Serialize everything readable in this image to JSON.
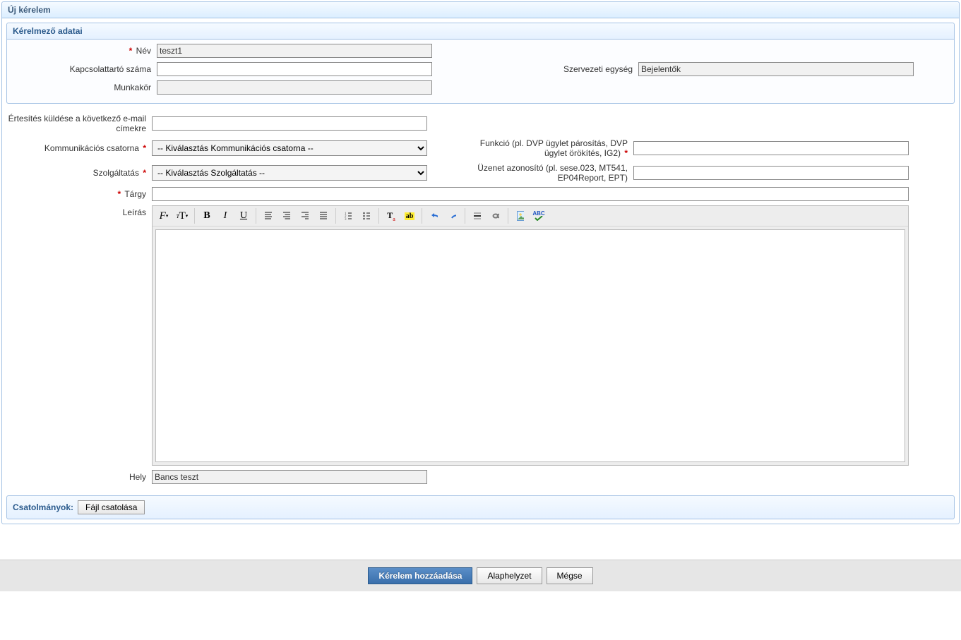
{
  "page": {
    "title": "Új kérelem"
  },
  "requester": {
    "section_title": "Kérelmező adatai",
    "labels": {
      "name": "Név",
      "contact_number": "Kapcsolattartó száma",
      "org_unit": "Szervezeti egység",
      "role": "Munkakör"
    },
    "values": {
      "name": "teszt1",
      "contact_number": "",
      "org_unit": "Bejelentők",
      "role": ""
    }
  },
  "details": {
    "labels": {
      "notify_emails": "Értesítés küldése a következő e-mail címekre",
      "comm_channel": "Kommunikációs csatorna",
      "function": "Funkció (pl. DVP ügylet párosítás, DVP ügylet örökítés, IG2)",
      "service": "Szolgáltatás",
      "message_id": "Üzenet azonosító (pl. sese.023, MT541, EP04Report, EPT)",
      "subject": "Tárgy",
      "description": "Leírás",
      "location": "Hely"
    },
    "values": {
      "notify_emails": "",
      "comm_channel": "-- Kiválasztás Kommunikációs csatorna --",
      "function": "",
      "service": "-- Kiválasztás Szolgáltatás --",
      "message_id": "",
      "subject": "",
      "location": "Bancs teszt"
    }
  },
  "attachments": {
    "label": "Csatolmányok:",
    "button": "Fájl csatolása"
  },
  "footer": {
    "submit": "Kérelem hozzáadása",
    "reset": "Alaphelyzet",
    "cancel": "Mégse"
  },
  "icons": {
    "font_family": "font-family-icon",
    "font_size": "font-size-icon",
    "bold": "bold-icon",
    "italic": "italic-icon",
    "underline": "underline-icon",
    "align_left": "align-left-icon",
    "align_center": "align-center-icon",
    "align_right": "align-right-icon",
    "align_justify": "align-justify-icon",
    "ordered_list": "ordered-list-icon",
    "unordered_list": "unordered-list-icon",
    "text_color": "text-color-icon",
    "highlight": "highlight-icon",
    "undo": "undo-icon",
    "redo": "redo-icon",
    "hr": "horizontal-rule-icon",
    "link": "link-icon",
    "image": "image-icon",
    "spellcheck": "spellcheck-icon"
  }
}
